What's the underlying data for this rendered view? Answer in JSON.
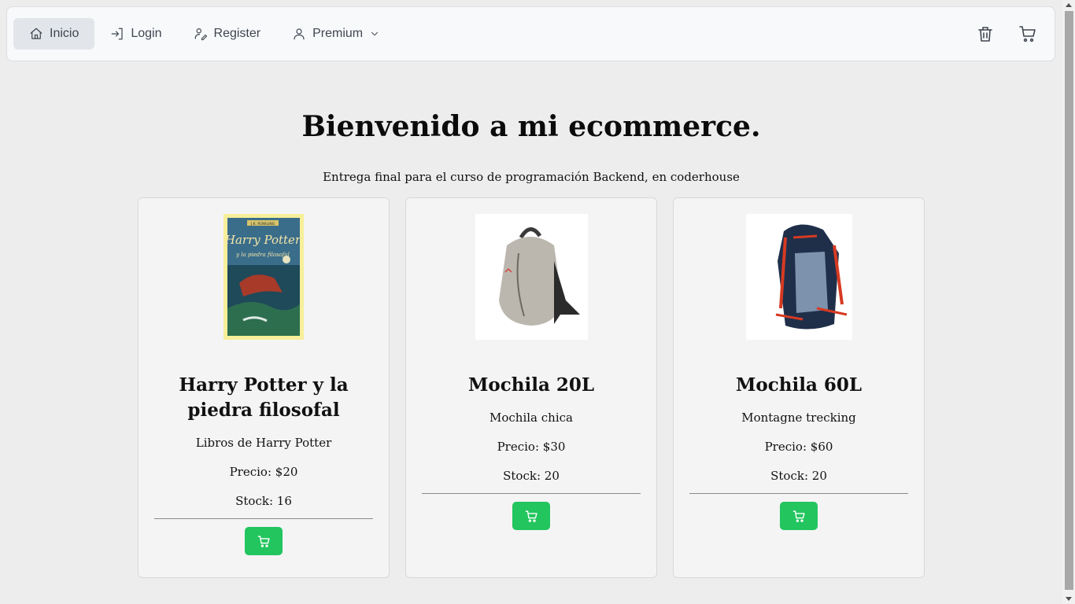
{
  "nav": {
    "items": [
      {
        "label": "Inicio",
        "icon": "home-icon"
      },
      {
        "label": "Login",
        "icon": "login-icon"
      },
      {
        "label": "Register",
        "icon": "register-icon"
      },
      {
        "label": "Premium",
        "icon": "user-icon"
      }
    ],
    "right_icons": [
      "trash-icon",
      "cart-icon"
    ]
  },
  "hero": {
    "title": "Bienvenido a mi ecommerce.",
    "subtitle": "Entrega final para el curso de programación Backend, en coderhouse"
  },
  "products": [
    {
      "title": "Harry Potter y la piedra filosofal",
      "description": "Libros de Harry Potter",
      "price": "Precio: $20",
      "stock": "Stock: 16",
      "image": "harry-potter-book-cover"
    },
    {
      "title": "Mochila 20L",
      "description": "Mochila chica",
      "price": "Precio: $30",
      "stock": "Stock: 20",
      "image": "grey-backpack"
    },
    {
      "title": "Mochila 60L",
      "description": "Montagne trecking",
      "price": "Precio: $60",
      "stock": "Stock: 20",
      "image": "trekking-backpack"
    }
  ],
  "colors": {
    "accent": "#22c55e",
    "background": "#ededed",
    "card": "#f4f4f5"
  },
  "book_cover": {
    "author": "J.K. ROWLING",
    "title": "Harry Potter",
    "subtitle": "y la piedra filosofal"
  }
}
